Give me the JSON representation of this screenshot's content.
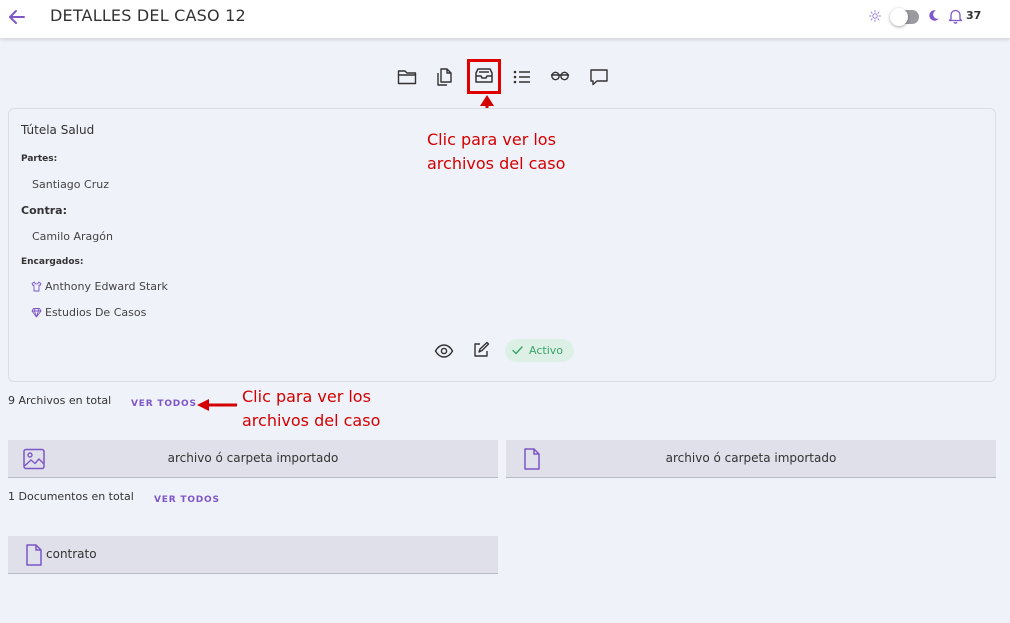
{
  "header": {
    "title": "DETALLES DEL CASO 12",
    "notification_count": "37"
  },
  "toolbar": {
    "icons": [
      "folder-icon",
      "documents-icon",
      "inbox-icon",
      "list-icon",
      "glasses-icon",
      "comment-icon"
    ],
    "highlighted": "inbox-icon"
  },
  "case": {
    "title": "Tútela Salud",
    "parties_label": "Partes:",
    "party": "Santiago Cruz",
    "against_label": "Contra:",
    "opponent": "Camilo Aragón",
    "assigned_label": "Encargados:",
    "assignees": [
      "Anthony Edward Stark",
      "Estudios De Casos"
    ],
    "status": "Activo"
  },
  "annotations": {
    "top_line1": "Clic para ver los",
    "top_line2": "archivos del caso",
    "side_line1": "Clic para ver los",
    "side_line2": "archivos del caso"
  },
  "files": {
    "count_text": "9 Archivos en total",
    "see_all": "VER TODOS",
    "items": [
      {
        "name": "archivo ó carpeta importado",
        "icon": "image-icon"
      },
      {
        "name": "archivo ó carpeta importado",
        "icon": "file-icon"
      }
    ]
  },
  "documents": {
    "count_text": "1 Documentos en total",
    "see_all": "VER TODOS",
    "items": [
      {
        "name": "contrato",
        "icon": "file-icon"
      }
    ]
  },
  "colors": {
    "accent": "#7d56c7",
    "annotation": "#d40000",
    "status_bg": "#ddf0e6",
    "status_text": "#3aa36b",
    "background": "#f0f2fa"
  }
}
